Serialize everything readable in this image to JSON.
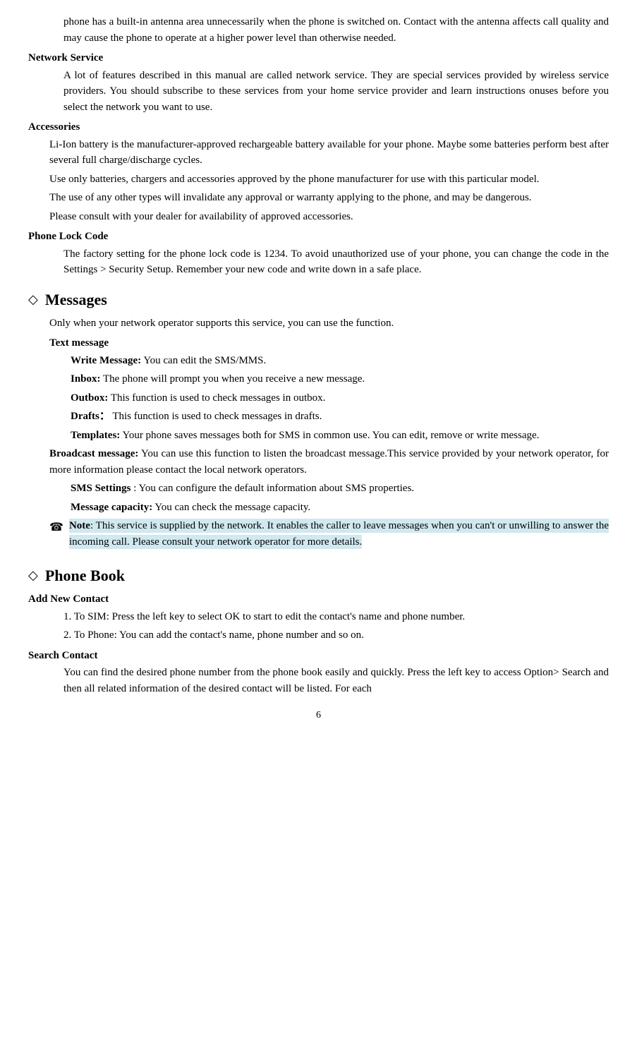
{
  "content": {
    "intro_para1": "phone has a built-in antenna area unnecessarily when the phone is switched on. Contact with the antenna affects call quality and may cause the phone to operate at a higher power level than otherwise needed.",
    "network_service_heading": "Network Service",
    "network_service_para": "A lot of features described in this manual are called network service. They are special services provided by wireless service providers. You should subscribe to these services from your home service provider and learn instructions onuses before you select the network you want to use.",
    "accessories_heading": "Accessories",
    "accessories_para1": "Li-Ion battery is the manufacturer-approved rechargeable battery available for your phone. Maybe some batteries perform best after several full charge/discharge cycles.",
    "accessories_para2": "Use only batteries, chargers and accessories approved by the phone manufacturer for use with this particular model.",
    "accessories_para3": "The use of any other types will invalidate any approval or warranty applying to the phone, and may be dangerous.",
    "accessories_para4": "Please consult with your dealer for availability of approved accessories.",
    "phone_lock_heading": "Phone Lock Code",
    "phone_lock_para": "The factory setting for the phone lock code is 1234. To avoid unauthorized use of your phone, you can change the code in the Settings > Security Setup. Remember your new code and write down in a safe place.",
    "messages_title": "Messages",
    "messages_intro": "Only when your network operator supports this service, you can use the function.",
    "text_message_heading": "Text message",
    "write_message_label": "Write Message:",
    "write_message_text": "You can edit the SMS/MMS.",
    "inbox_label": "Inbox:",
    "inbox_text": "The phone will prompt you when you receive a new message.",
    "outbox_label": "Outbox:",
    "outbox_text": "This function is used to check messages in outbox.",
    "drafts_label": "Drafts：",
    "drafts_text": "This function is used to check messages in drafts.",
    "templates_label": "Templates:",
    "templates_text": "Your phone saves messages both for SMS in common use. You can edit, remove or write message.",
    "broadcast_label": "Broadcast message:",
    "broadcast_text": "You can use this function to listen the broadcast message.This service provided by your network operator, for more information please contact the local network operators.",
    "sms_settings_label": "SMS Settings",
    "sms_settings_text": ": You can configure the default information about SMS properties.",
    "msg_capacity_label": "Message capacity:",
    "msg_capacity_text": "You can check the message capacity.",
    "note_icon": "☎",
    "note_bold": "Note",
    "note_text": ": This service is supplied by the network. It enables the caller to leave messages when you can't or unwilling to answer the incoming call. Please consult your network operator for more details.",
    "phone_book_title": "Phone Book",
    "add_new_contact_heading": "Add New Contact",
    "add_contact_1": "1. To SIM: Press the left key to select OK to start to edit the contact's name and phone number.",
    "add_contact_2": "2. To Phone: You can add the contact's name, phone number and so on.",
    "search_contact_heading": "Search Contact",
    "search_contact_para": "You can find the desired phone number from the phone book easily and quickly. Press the left key to access Option> Search and then all related information of the desired contact will be listed. For each",
    "page_number": "6",
    "diamond": "◇"
  }
}
